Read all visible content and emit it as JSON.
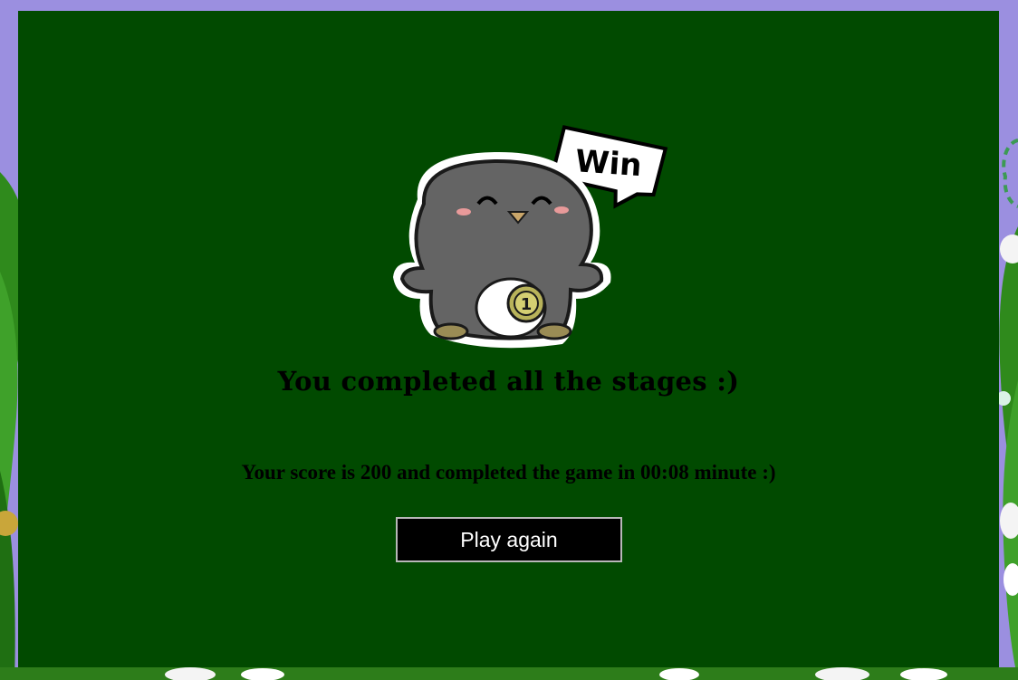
{
  "colors": {
    "page_background": "#9b8fe0",
    "modal_background": "#014a00",
    "button_background": "#000000",
    "button_border": "#b8b8b8",
    "button_text": "#ffffff",
    "text": "#000000"
  },
  "mascot": {
    "icon": "penguin-win-icon",
    "speech_bubble": "Win",
    "coin_label": "1"
  },
  "win_screen": {
    "title": "You completed all the stages :)",
    "score_line": "Your score is 200 and completed the game in 00:08 minute :)",
    "play_again_label": "Play again"
  }
}
